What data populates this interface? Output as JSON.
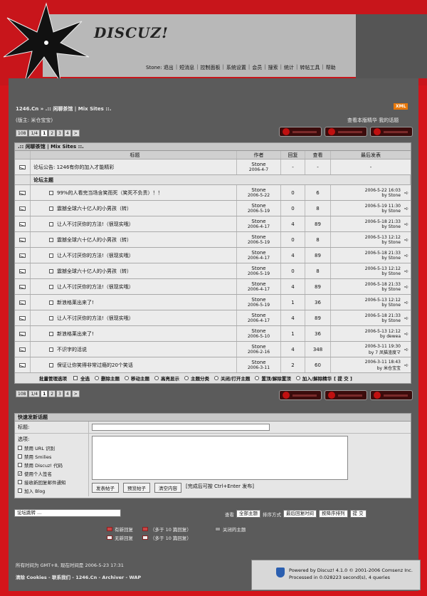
{
  "logo": "DISCUZ!",
  "topnav": [
    "Stone: 退出",
    "短消息",
    "控制面板",
    "系统设置",
    "会员",
    "搜索",
    "统计",
    "转帖工具",
    "帮助"
  ],
  "breadcrumb": "1246.Cn » .:: 闲聊茶馆 | Mix Sites ::.",
  "xml_label": "XML",
  "moderator": "(版主: 米仓宝宝)",
  "toplinks": "查看本版精华  我的话题",
  "pager": {
    "total": "108",
    "pages": "1/4",
    "items": [
      "1",
      "2",
      "3",
      "4",
      ">"
    ]
  },
  "table_title": ".:: 闲聊茶馆 | Mix Sites ::.",
  "headers": {
    "title": "标题",
    "author": "作者",
    "replies": "回复",
    "views": "查看",
    "last": "最后发表"
  },
  "announce": {
    "title": "论坛公告: 1246有你的加入才能精彩",
    "author": "Stone",
    "date": "2006-4-7",
    "replies": "-",
    "views": "-",
    "last": "-"
  },
  "section": "论坛主题",
  "threads": [
    {
      "title": "99%的人看完当场含笑而死（笑死不负责）！！",
      "author": "Stone",
      "date": "2006-5-22",
      "replies": "0",
      "views": "6",
      "last": "2006-5-22 16:03",
      "by": "by Stone"
    },
    {
      "title": "震撼全球六十亿人的小男孩（转）",
      "author": "Stone",
      "date": "2006-5-19",
      "replies": "0",
      "views": "8",
      "last": "2006-5-19 11:30",
      "by": "by Stone"
    },
    {
      "title": "让人不讨厌你的方法!（很现实哦）",
      "author": "Stone",
      "date": "2006-4-17",
      "replies": "4",
      "views": "89",
      "last": "2006-5-18 21:33",
      "by": "by Stone"
    },
    {
      "title": "震撼全球六十亿人的小男孩（转）",
      "author": "Stone",
      "date": "2006-5-19",
      "replies": "0",
      "views": "8",
      "last": "2006-5-13 12:12",
      "by": "by Stone"
    },
    {
      "title": "让人不讨厌你的方法!（很现实哦）",
      "author": "Stone",
      "date": "2006-4-17",
      "replies": "4",
      "views": "89",
      "last": "2006-5-18 21:33",
      "by": "by Stone"
    },
    {
      "title": "震撼全球六十亿人的小男孩（转）",
      "author": "Stone",
      "date": "2006-5-19",
      "replies": "0",
      "views": "8",
      "last": "2006-5-13 12:12",
      "by": "by Stone"
    },
    {
      "title": "让人不讨厌你的方法!（很现实哦）",
      "author": "Stone",
      "date": "2006-4-17",
      "replies": "4",
      "views": "89",
      "last": "2006-5-18 21:33",
      "by": "by Stone"
    },
    {
      "title": "新浪格莱出来了!",
      "author": "Stone",
      "date": "2006-5-19",
      "replies": "1",
      "views": "36",
      "last": "2006-5-13 12:12",
      "by": "by Stone"
    },
    {
      "title": "让人不讨厌你的方法!（很现实哦）",
      "author": "Stone",
      "date": "2006-4-17",
      "replies": "4",
      "views": "89",
      "last": "2006-5-18 21:33",
      "by": "by Stone"
    },
    {
      "title": "新浪格莱出来了!",
      "author": "Stone",
      "date": "2006-5-10",
      "replies": "1",
      "views": "36",
      "last": "2006-5-13 12:12",
      "by": "by dewea"
    },
    {
      "title": "不识字的活说",
      "author": "Stone",
      "date": "2006-2-16",
      "replies": "4",
      "views": "348",
      "last": "2006-3-11 19:30",
      "by": "by 7 凤猫渣度マ"
    },
    {
      "title": "保证让你笑得非常过瘾的20个笑话",
      "author": "Stone",
      "date": "2006-3-11",
      "replies": "2",
      "views": "60",
      "last": "2006-3-11 18:43",
      "by": "by 米仓宝宝"
    }
  ],
  "batch": {
    "label": "批量管理选项",
    "options": [
      "全选",
      "删除主题",
      "移动主题",
      "高亮显示",
      "主题分类",
      "关闭/打开主题",
      "置顶/解除置顶",
      "加入/解除精华"
    ],
    "submit": "[ 提 交 ]"
  },
  "quick": {
    "title": "快速发新话题",
    "subject_label": "标题:",
    "options_label": "选项:",
    "options": [
      {
        "label": "禁用 URL 识别",
        "checked": false
      },
      {
        "label": "禁用 Smilies",
        "checked": false
      },
      {
        "label": "禁用 Discuz! 代码",
        "checked": false
      },
      {
        "label": "使用个人签名",
        "checked": true
      },
      {
        "label": "接收新回复邮件通知",
        "checked": false
      },
      {
        "label": "加入 Blog",
        "checked": false
      }
    ],
    "buttons": [
      "发表帖子",
      "预览帖子",
      "清空内容"
    ],
    "hint": "[完成后可按 Ctrl+Enter 发布]"
  },
  "jump": "论坛跳转 ...",
  "sort": {
    "view_label": "查看",
    "view": "全部主题",
    "order_label": "排序方式",
    "order": "最后回复时间",
    "dir": "按降序排列",
    "go": "提 交"
  },
  "legend": [
    {
      "icon": "有新回复",
      "extra": "（多于 10 篇回复）"
    },
    {
      "icon": "无新回复",
      "extra": "（多于 10 篇回复）"
    }
  ],
  "closed": "关闭的主题",
  "footer_time": "所有时间为 GMT+8, 现在时间是 2006-5-23 17:31",
  "footer_links": "清除 Cookies - 联系我们 - 1246.Cn - Archiver - WAP",
  "powered1": "Powered by Discuz! 4.1.0  © 2001-2006 Comsenz Inc.",
  "powered2": "Processed in 0.028223 second(s), 4 queries"
}
